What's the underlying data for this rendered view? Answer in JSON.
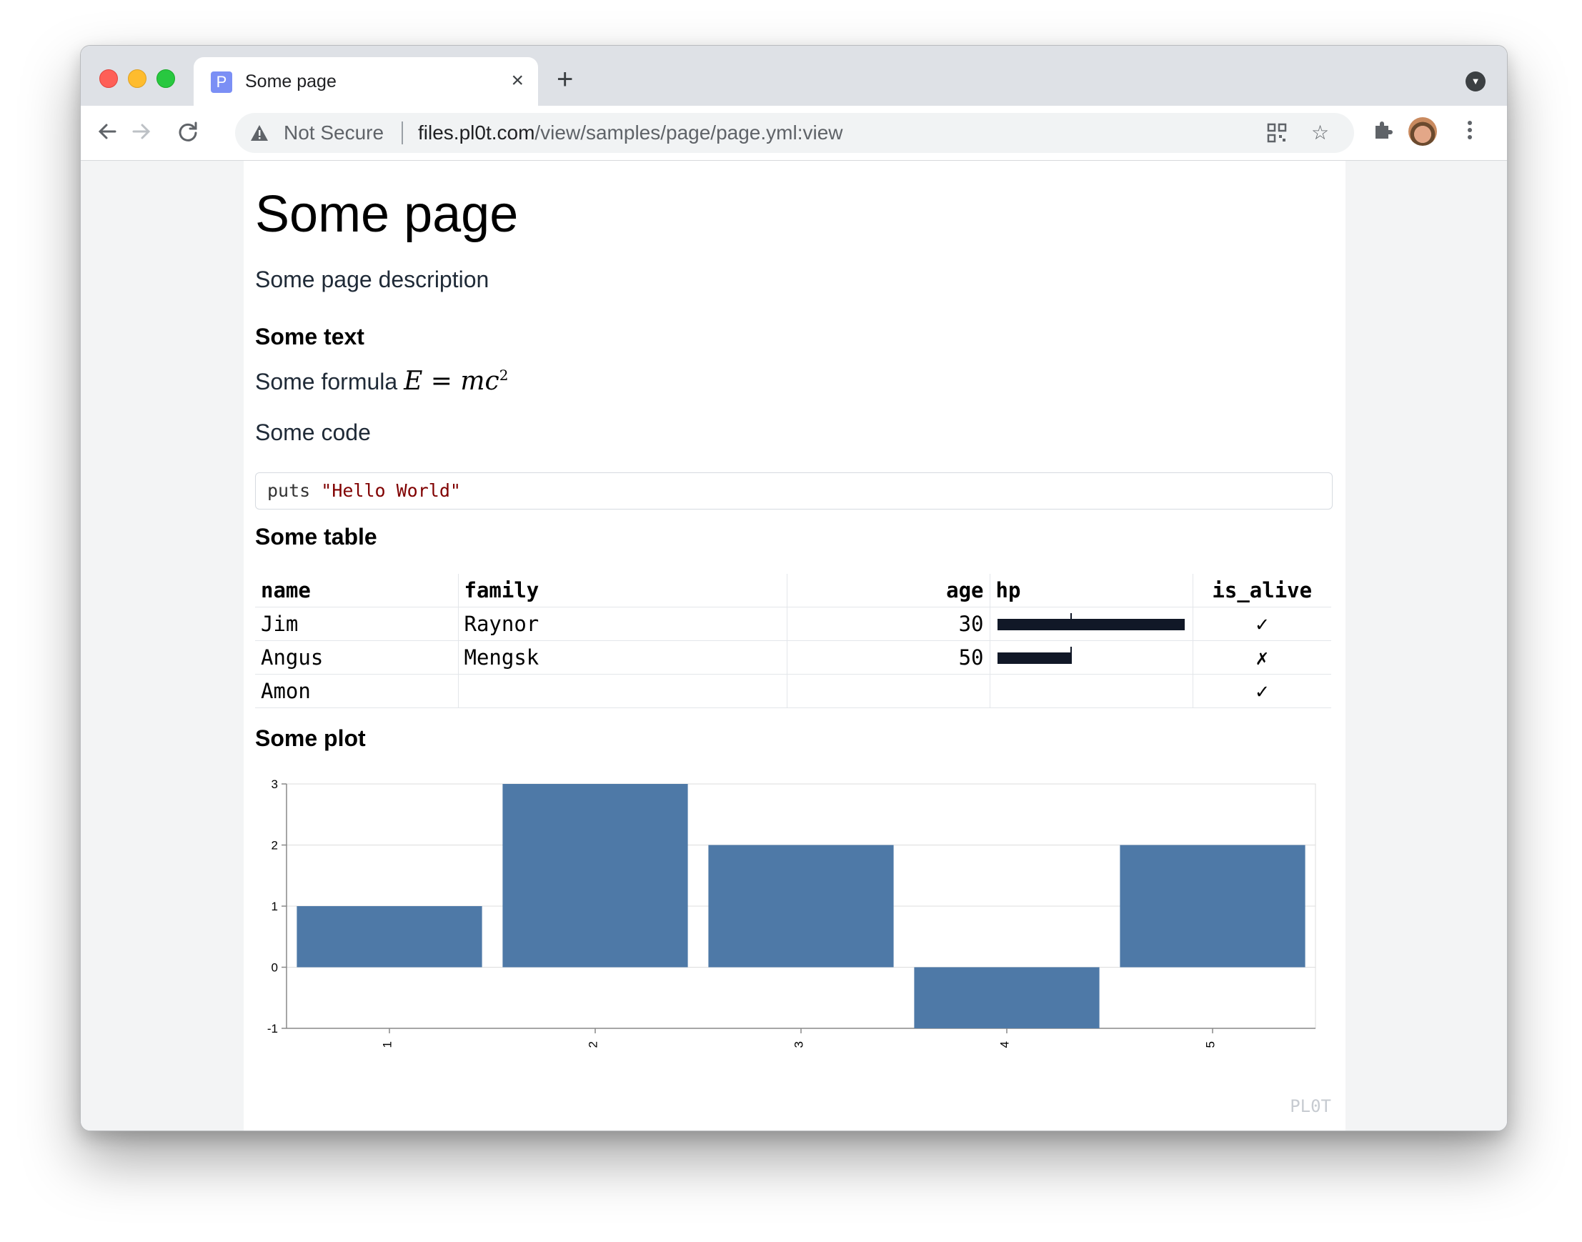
{
  "browser": {
    "tab_title": "Some page",
    "tab_favicon_letter": "P",
    "tab_close_icon": "×",
    "new_tab_icon": "+",
    "not_secure": "Not Secure",
    "url_host": "files.pl0t.com",
    "url_path": "/view/samples/page/page.yml:view"
  },
  "page": {
    "title": "Some page",
    "description": "Some page description",
    "text_heading": "Some text",
    "formula_prefix": "Some formula",
    "formula_lhs": "E",
    "formula_eq": " = ",
    "formula_rhs": "mc",
    "formula_exp": "2",
    "code_label": "Some code",
    "code_keyword": "puts ",
    "code_string": "\"Hello World\"",
    "table_heading": "Some table",
    "plot_heading": "Some plot",
    "watermark": "PL0T"
  },
  "table": {
    "columns": [
      "name",
      "family",
      "age",
      "hp",
      "is_alive"
    ],
    "rows": [
      {
        "name": "Jim",
        "family": "Raynor",
        "age": "30",
        "hp_fraction": 1.0,
        "alive": "✓"
      },
      {
        "name": "Angus",
        "family": "Mengsk",
        "age": "50",
        "hp_fraction": 0.4,
        "alive": "✗"
      },
      {
        "name": "Amon",
        "family": "",
        "age": "",
        "hp_fraction": null,
        "alive": "✓"
      }
    ]
  },
  "chart_data": {
    "type": "bar",
    "categories": [
      "1",
      "2",
      "3",
      "4",
      "5"
    ],
    "values": [
      1,
      3,
      2,
      -1,
      2
    ],
    "ylim": [
      -1,
      3
    ],
    "yticks": [
      "3",
      "2",
      "1",
      "0",
      "-1"
    ],
    "grid": true,
    "bar_color": "#4e79a7"
  }
}
